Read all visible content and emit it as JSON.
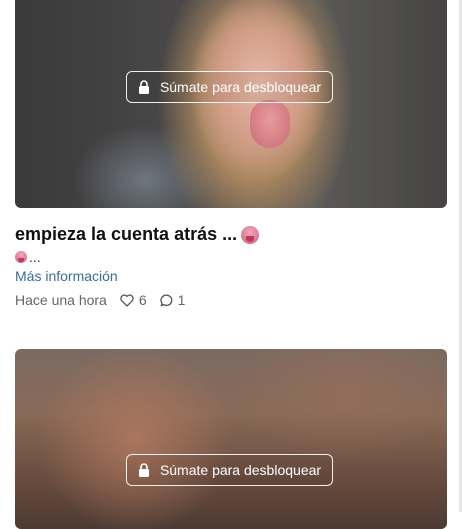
{
  "posts": [
    {
      "unlock_label": "Súmate para desbloquear",
      "title": "empieza la cuenta atrás ...",
      "title_emoji": "tongue-emoji",
      "excerpt": "...",
      "excerpt_emoji": "tongue-emoji",
      "more_label": "Más información",
      "time": "Hace una hora",
      "likes": "6",
      "comments": "1"
    },
    {
      "unlock_label": "Súmate para desbloquear"
    }
  ],
  "icons": {
    "lock": "lock-icon",
    "like": "heart-icon",
    "comment": "comment-icon"
  },
  "colors": {
    "link": "#3d6b94",
    "meta_text": "#666666",
    "title_text": "#111111"
  }
}
